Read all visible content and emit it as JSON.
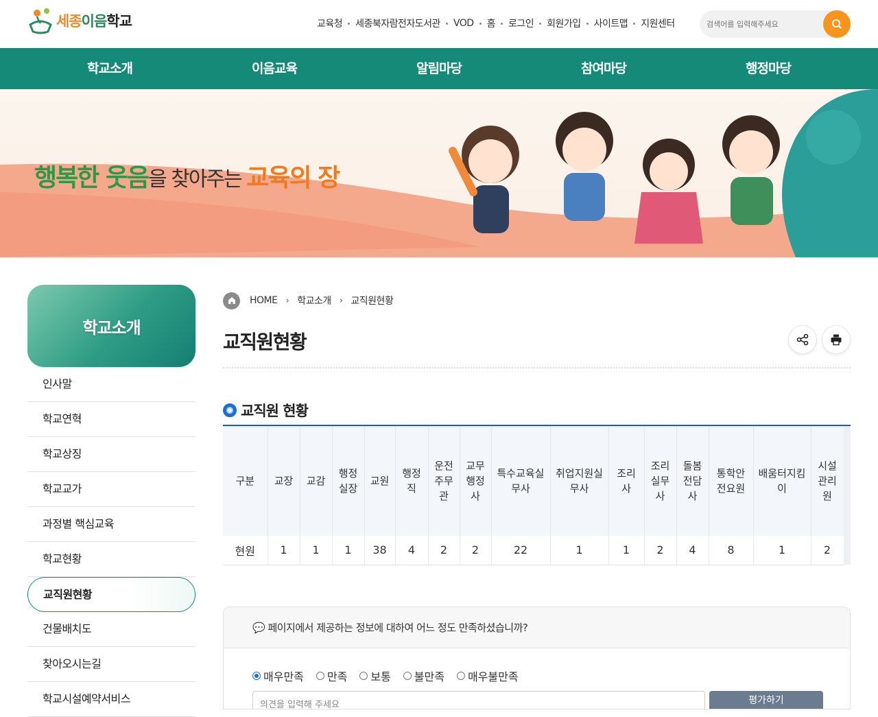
{
  "header": {
    "logo_text_1": "세종",
    "logo_text_2": "이음",
    "logo_text_3": "학교",
    "util_links": [
      "교육청",
      "세종북자람전자도서관",
      "VOD",
      "홈",
      "로그인",
      "회원가입",
      "사이트맵",
      "지원센터"
    ],
    "search_placeholder": "검색어를 입력해주세요"
  },
  "gnb": [
    "학교소개",
    "이음교육",
    "알림마당",
    "참여마당",
    "행정마당"
  ],
  "visual": {
    "slogan_1": "행복한 웃음",
    "slogan_2": "을 찾아주는 ",
    "slogan_3": "교육의 장"
  },
  "lnb": {
    "title": "학교소개",
    "items": [
      "인사말",
      "학교연혁",
      "학교상징",
      "학교교가",
      "과정별 핵심교육",
      "학교현황",
      "교직원현황",
      "건물배치도",
      "찾아오시는길",
      "학교시설예약서비스"
    ],
    "active_index": 6
  },
  "breadcrumb": [
    "HOME",
    "학교소개",
    "교직원현황"
  ],
  "page_title": "교직원현황",
  "section_title": "교직원 현황",
  "staff_table": {
    "headers": [
      "구분",
      "교장",
      "교감",
      "행정실장",
      "교원",
      "행정직",
      "운전주무관",
      "교무행정사",
      "특수교육실무사",
      "취업지원실무사",
      "조리사",
      "조리실무사",
      "돌봄전담사",
      "통학안전요원",
      "배움터지킴이",
      "시설관리원"
    ],
    "row_label": "현원",
    "values": [
      1,
      1,
      1,
      38,
      4,
      2,
      2,
      22,
      1,
      1,
      2,
      4,
      8,
      1,
      2
    ]
  },
  "survey": {
    "question": "페이지에서 제공하는 정보에 대하여 어느 정도 만족하셨습니까?",
    "options": [
      "매우만족",
      "만족",
      "보통",
      "불만족",
      "매우불만족"
    ],
    "selected_index": 0,
    "input_placeholder": "의견을 입력해 주세요",
    "submit_label": "평가하기"
  },
  "colors": {
    "gnb_bg": "#168a79",
    "accent_orange": "#f7941d",
    "table_top_border": "#1a5fb0"
  }
}
